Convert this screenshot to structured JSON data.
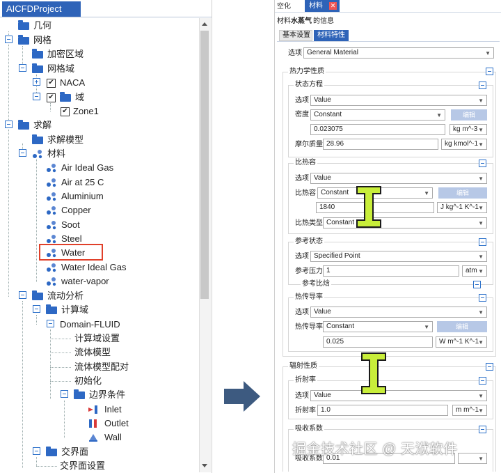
{
  "left": {
    "tab_label": "AICFDProject",
    "tree": [
      {
        "label": "几何"
      },
      {
        "label": "网格"
      },
      {
        "label": "加密区域"
      },
      {
        "label": "网格域"
      },
      {
        "label": "NACA"
      },
      {
        "label": "域"
      },
      {
        "label": "Zone1"
      },
      {
        "label": "求解"
      },
      {
        "label": "求解模型"
      },
      {
        "label": "材料"
      },
      {
        "label": "Air Ideal Gas"
      },
      {
        "label": "Air at 25 C"
      },
      {
        "label": "Aluminium"
      },
      {
        "label": "Copper"
      },
      {
        "label": "Soot"
      },
      {
        "label": "Steel"
      },
      {
        "label": "Water"
      },
      {
        "label": "Water Ideal Gas"
      },
      {
        "label": "water-vapor"
      },
      {
        "label": "流动分析"
      },
      {
        "label": "计算域"
      },
      {
        "label": "Domain-FLUID"
      },
      {
        "label": "计算域设置"
      },
      {
        "label": "流体模型"
      },
      {
        "label": "流体模型配对"
      },
      {
        "label": "初始化"
      },
      {
        "label": "边界条件"
      },
      {
        "label": "Inlet"
      },
      {
        "label": "Outlet"
      },
      {
        "label": "Wall"
      },
      {
        "label": "交界面"
      },
      {
        "label": "交界面设置"
      }
    ]
  },
  "right": {
    "top_tab_1": "空化",
    "top_tab_2": "材料",
    "info_prefix": "材料",
    "info_name": "水蒸气",
    "info_suffix": "的信息",
    "sub_tab_basic": "基本设置",
    "sub_tab_props": "材料特性",
    "option_label": "选项",
    "option_value": "General Material",
    "thermo_title": "热力学性质",
    "eos_title": "状态方程",
    "eos_option_label": "选项",
    "eos_option_value": "Value",
    "density_label": "密度",
    "density_mode": "Constant",
    "edit_label": "编辑",
    "density_value": "0.023075",
    "density_unit": "kg m^-3",
    "molar_label": "摩尔质量",
    "molar_value": "28.96",
    "molar_unit": "kg kmol^-1",
    "cp_title": "比热容",
    "cp_option_label": "选项",
    "cp_option_value": "Value",
    "cp_label": "比热容",
    "cp_mode": "Constant",
    "cp_value": "1840",
    "cp_unit": "J kg^-1 K^-1",
    "cp_type_label": "比热类型",
    "cp_type_value": "Constant P",
    "ref_title": "参考状态",
    "ref_option_label": "选项",
    "ref_option_value": "Specified Point",
    "ref_pressure_label": "参考压力",
    "ref_pressure_value": "1",
    "ref_pressure_unit": "atm",
    "ref_enthalpy_label": "参考比焓",
    "tc_title": "热传导率",
    "tc_option_label": "选项",
    "tc_option_value": "Value",
    "tc_label": "热传导率",
    "tc_mode": "Constant",
    "tc_value": "0.025",
    "tc_unit": "W m^-1 K^-1",
    "rad_title": "辐射性质",
    "refr_title": "折射率",
    "refr_option_label": "选项",
    "refr_option_value": "Value",
    "refr_label": "折射率",
    "refr_value": "1.0",
    "refr_unit": "m m^-1",
    "abs_title": "吸收系数",
    "abs_label": "吸收系数",
    "abs_value": "0.01"
  },
  "watermark": "掘金技术社区 @ 天洑软件",
  "colors": {
    "tab_blue": "#2e63b8",
    "highlight_red": "#e0402a",
    "arrow": "#3d5a80",
    "ibeam_fill": "#c8ee3a"
  }
}
